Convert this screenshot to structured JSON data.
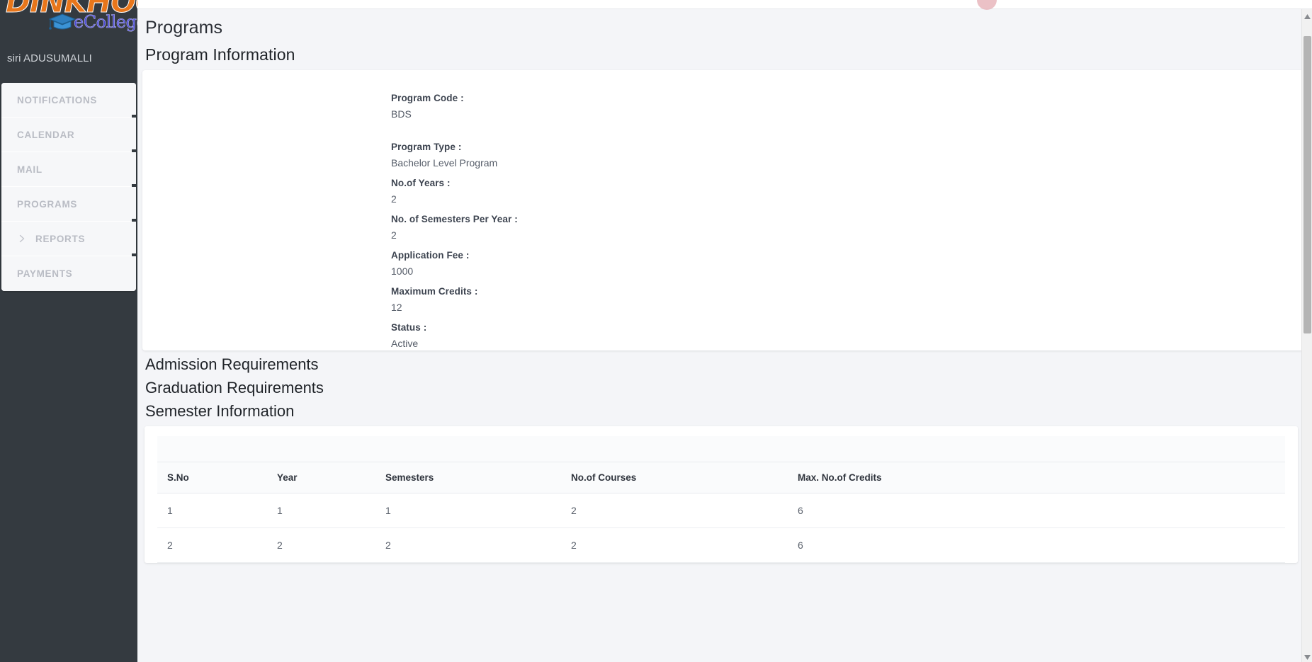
{
  "brand": {
    "word": "DINKHOO!",
    "sub": "eCollege",
    "cap_icon": "graduation-cap-icon"
  },
  "user": {
    "name": "siri ADUSUMALLI"
  },
  "sidebar": {
    "items": [
      {
        "label": "NOTIFICATIONS",
        "icon": ""
      },
      {
        "label": "CALENDAR",
        "icon": ""
      },
      {
        "label": "MAIL",
        "icon": ""
      },
      {
        "label": "PROGRAMS",
        "icon": ""
      },
      {
        "label": "REPORTS",
        "icon": "chevron-right-icon"
      },
      {
        "label": "PAYMENTS",
        "icon": ""
      }
    ]
  },
  "page": {
    "title": "Programs",
    "section_title": "Program Information"
  },
  "program_info": {
    "fields": [
      {
        "label": "Program Code :",
        "value": "BDS"
      },
      {
        "label": "Program Type :",
        "value": "Bachelor Level Program"
      },
      {
        "label": "No.of Years :",
        "value": "2"
      },
      {
        "label": "No. of Semesters Per Year :",
        "value": "2"
      },
      {
        "label": "Application Fee :",
        "value": "1000"
      },
      {
        "label": "Maximum Credits :",
        "value": "12"
      },
      {
        "label": "Status :",
        "value": "Active"
      }
    ]
  },
  "sections": {
    "admission": "Admission Requirements",
    "graduation": "Graduation Requirements",
    "semester": "Semester Information"
  },
  "semester_table": {
    "columns": [
      "S.No",
      "Year",
      "Semesters",
      "No.of Courses",
      "Max. No.of Credits"
    ],
    "rows": [
      {
        "sno": "1",
        "year": "1",
        "semesters": "1",
        "courses": "2",
        "credits": "6"
      },
      {
        "sno": "2",
        "year": "2",
        "semesters": "2",
        "courses": "2",
        "credits": "6"
      }
    ]
  },
  "colors": {
    "sidebar_bg": "#343a40",
    "brand_orange": "#e8761b",
    "brand_blue": "#4b4bd8",
    "page_bg": "#f4f5f8"
  }
}
